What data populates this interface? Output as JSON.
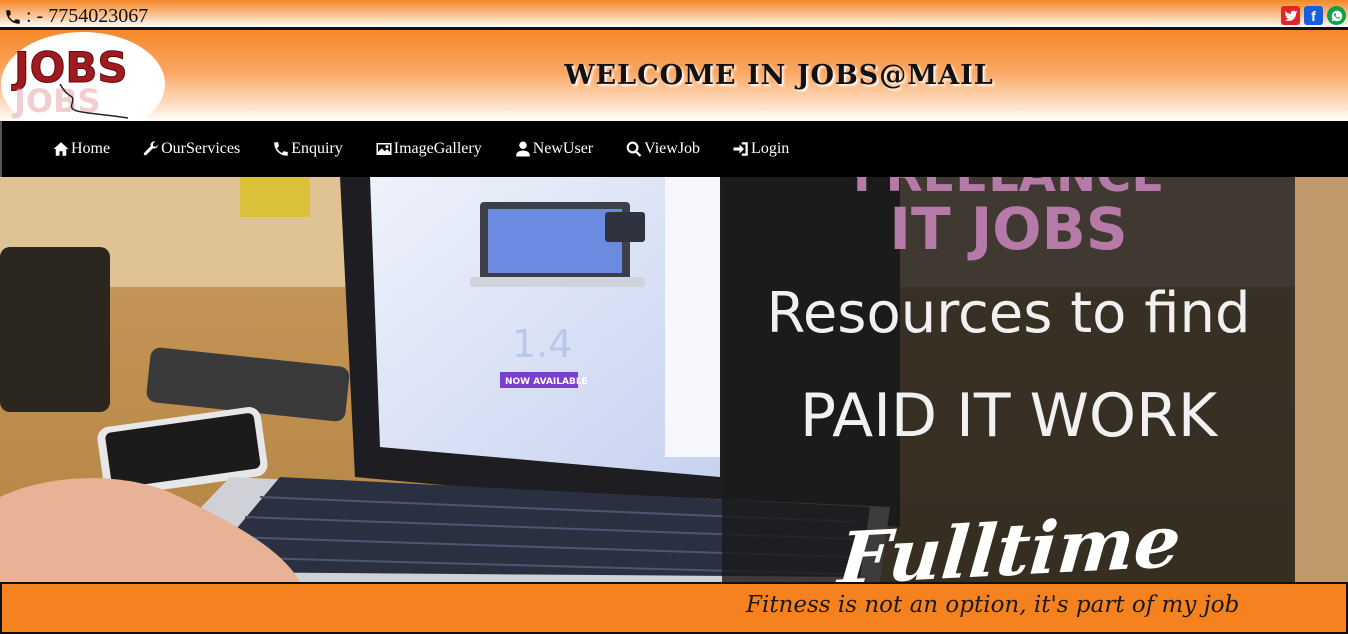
{
  "topbar": {
    "phone_text": ": - 7754023067",
    "social": [
      "twitter-icon",
      "facebook-icon",
      "whatsapp-icon"
    ]
  },
  "header": {
    "logo_text": "JOBS",
    "title": "WELCOME  IN  JOBS@MAIL"
  },
  "nav": {
    "items": [
      {
        "label": "Home",
        "icon": "home-icon"
      },
      {
        "label": "OurServices",
        "icon": "wrench-icon"
      },
      {
        "label": "Enquiry",
        "icon": "phone-icon"
      },
      {
        "label": "ImageGallery",
        "icon": "picture-icon"
      },
      {
        "label": "NewUser",
        "icon": "user-icon"
      },
      {
        "label": "ViewJob",
        "icon": "search-icon"
      },
      {
        "label": "Login",
        "icon": "login-icon"
      }
    ]
  },
  "hero": {
    "line_top": "FREELANCE",
    "line_it": "IT JOBS",
    "line_res": "Resources to find",
    "line_paid": "PAID IT WORK",
    "line_full": "Fulltime",
    "now_available": "NOW AVAILABLE",
    "version": "1.4"
  },
  "footer": {
    "tagline": "Fitness is not an option, it's part of my job"
  },
  "colors": {
    "accent": "#f5821f",
    "nav_bg": "#000000",
    "purple_text": "#b57aa7"
  }
}
